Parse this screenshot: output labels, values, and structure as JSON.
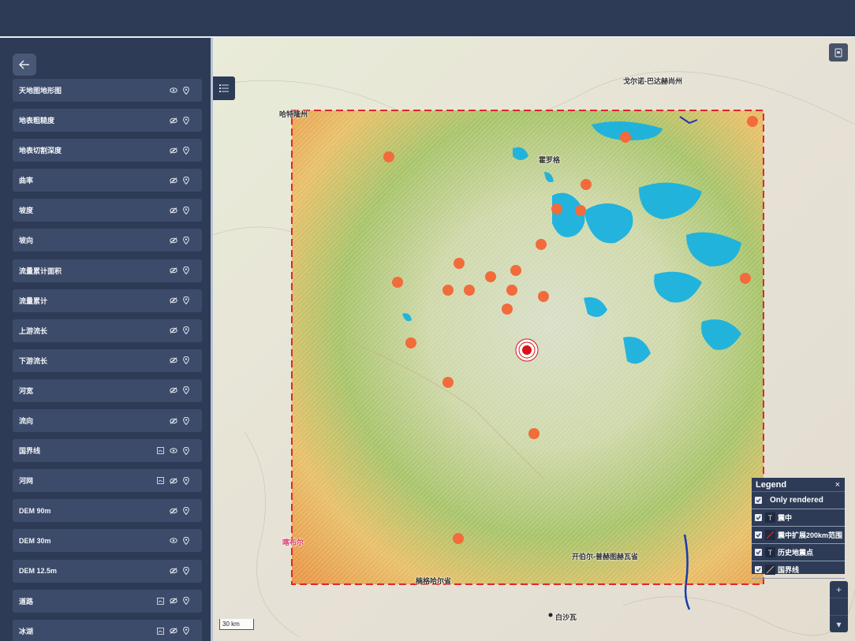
{
  "sidebar": {
    "back_icon": "arrow-left-icon",
    "layers": [
      {
        "label": "天地图地形图",
        "visible": true,
        "has_legend": false
      },
      {
        "label": "地表粗糙度",
        "visible": false,
        "has_legend": false
      },
      {
        "label": "地表切割深度",
        "visible": false,
        "has_legend": false
      },
      {
        "label": "曲率",
        "visible": false,
        "has_legend": false
      },
      {
        "label": "坡度",
        "visible": false,
        "has_legend": false
      },
      {
        "label": "坡向",
        "visible": false,
        "has_legend": false
      },
      {
        "label": "流量累计面积",
        "visible": false,
        "has_legend": false
      },
      {
        "label": "流量累计",
        "visible": false,
        "has_legend": false
      },
      {
        "label": "上游流长",
        "visible": false,
        "has_legend": false
      },
      {
        "label": "下游流长",
        "visible": false,
        "has_legend": false
      },
      {
        "label": "河宽",
        "visible": false,
        "has_legend": false
      },
      {
        "label": "流向",
        "visible": false,
        "has_legend": false
      },
      {
        "label": "国界线",
        "visible": true,
        "has_legend": true
      },
      {
        "label": "河网",
        "visible": false,
        "has_legend": true
      },
      {
        "label": "DEM 90m",
        "visible": false,
        "has_legend": false
      },
      {
        "label": "DEM 30m",
        "visible": true,
        "has_legend": false
      },
      {
        "label": "DEM 12.5m",
        "visible": false,
        "has_legend": false
      },
      {
        "label": "道路",
        "visible": false,
        "has_legend": true
      },
      {
        "label": "冰湖",
        "visible": false,
        "has_legend": true
      }
    ]
  },
  "map": {
    "labels": {
      "l1": "哈特隆州",
      "l2": "戈尔诺-巴达赫尚州",
      "l3": "霍罗格",
      "l4": "喀布尔",
      "l5": "楠格哈尔省",
      "l6": "开伯尔-普赫图赫瓦省",
      "l7": "白沙瓦"
    },
    "scale_text": "30 km",
    "colors": {
      "boundary": "#e0262a",
      "epicenter": "#d8131a",
      "history_marker": "#f26b3a",
      "glacier": "#1ab2e0"
    }
  },
  "legend": {
    "title": "Legend",
    "close": "×",
    "only_rendered": "Only rendered",
    "items": [
      {
        "label": "震中",
        "symbol": "T"
      },
      {
        "label": "震中扩展200km范围",
        "symbol": "line"
      },
      {
        "label": "历史地震点",
        "symbol": "T"
      },
      {
        "label": "国界线",
        "symbol": "line"
      }
    ]
  },
  "zoom": {
    "in": "+",
    "out": "▾"
  }
}
